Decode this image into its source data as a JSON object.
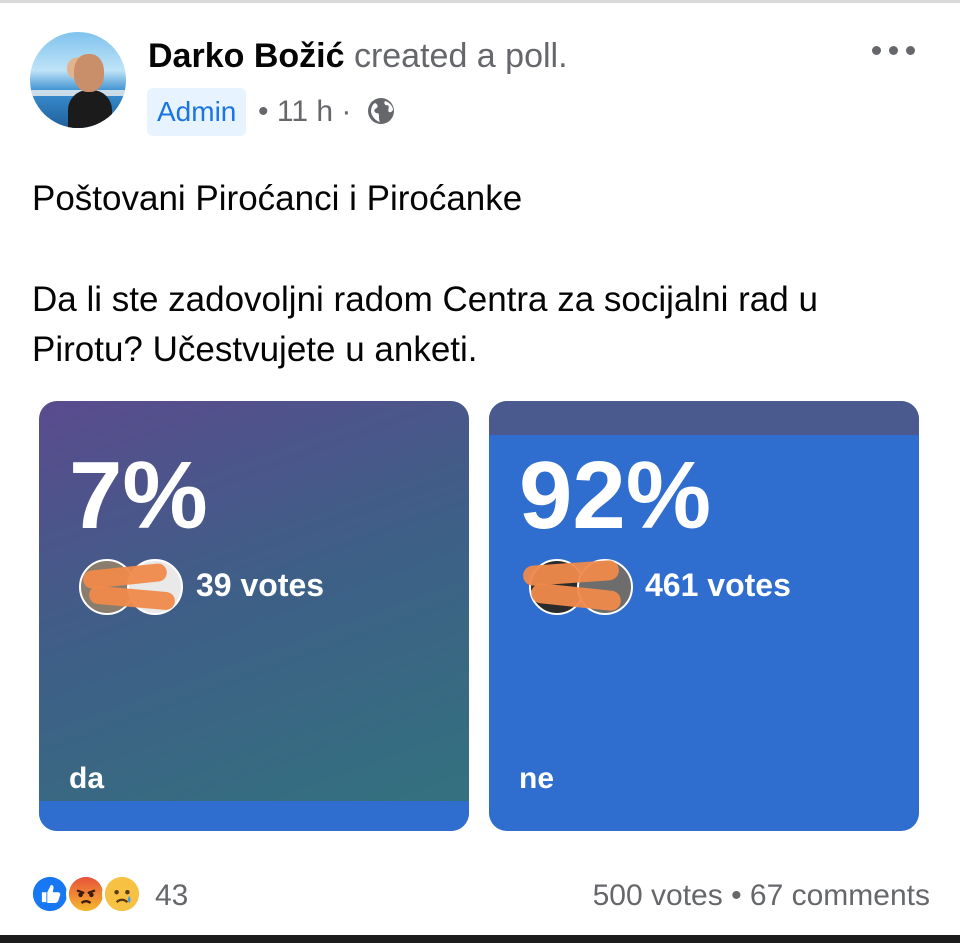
{
  "post": {
    "author_name": "Darko Božić",
    "action_text": "created a poll.",
    "badge": "Admin",
    "time": "11 h",
    "audience_icon": "globe-icon",
    "menu_icon": "more-icon"
  },
  "body": {
    "line1": "Poštovani Piroćanci i Piroćanke",
    "line2": "Da li ste zadovoljni radom Centra za socijalni rad u",
    "line3": "Pirotu? Učestvujete u anketi."
  },
  "poll": {
    "options": [
      {
        "label": "da",
        "percent": "7%",
        "votes": "39 votes",
        "share": 0.07
      },
      {
        "label": "ne",
        "percent": "92%",
        "votes": "461 votes",
        "share": 0.92
      }
    ]
  },
  "footer": {
    "reaction_icons": [
      "like-icon",
      "angry-icon",
      "sad-icon"
    ],
    "reaction_count": "43",
    "total_votes": "500 votes",
    "separator": "•",
    "comments": "67 comments"
  },
  "colors": {
    "accent": "#1b74e4",
    "option_da": "#3e5f87",
    "option_ne": "#2f6dcf",
    "redaction": "#f08a4b"
  }
}
